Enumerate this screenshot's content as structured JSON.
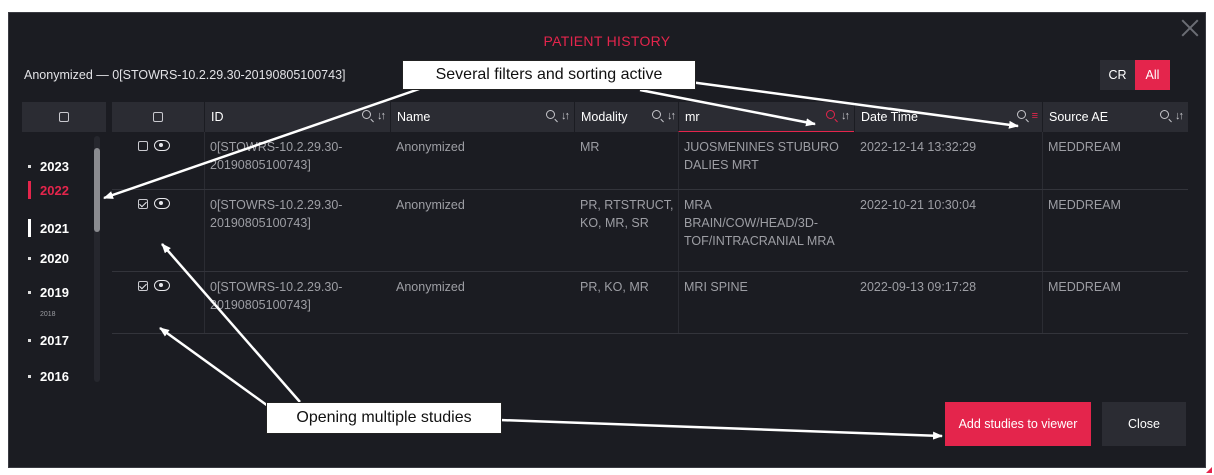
{
  "dialog": {
    "title": "PATIENT HISTORY",
    "patient_label": "Anonymized — 0[STOWRS-10.2.29.30-20190805100743]",
    "filter_buttons": [
      {
        "label": "CR",
        "active": false
      },
      {
        "label": "All",
        "active": true
      }
    ],
    "accent_color": "#e4254c"
  },
  "years": [
    {
      "label": "2023",
      "state": "normal"
    },
    {
      "label": "2022",
      "state": "active"
    },
    {
      "label": "2021",
      "state": "wide"
    },
    {
      "label": "2020",
      "state": "normal"
    },
    {
      "label": "2019",
      "state": "normal"
    },
    {
      "label": "2018",
      "state": "small"
    },
    {
      "label": "2017",
      "state": "normal"
    },
    {
      "label": "2016",
      "state": "normal"
    }
  ],
  "table": {
    "headers": {
      "id": "ID",
      "name": "Name",
      "modality": "Modality",
      "description_filter": "mr",
      "datetime": "Date Time",
      "source": "Source AE"
    },
    "rows": [
      {
        "checked": false,
        "id": "0[STOWRS-10.2.29.30-20190805100743]",
        "name": "Anonymized",
        "modality": "MR",
        "description": "JUOSMENINES STUBURO DALIES MRT",
        "datetime": "2022-12-14 13:32:29",
        "source": "MEDDREAM"
      },
      {
        "checked": true,
        "id": "0[STOWRS-10.2.29.30-20190805100743]",
        "name": "Anonymized",
        "modality": "PR, RTSTRUCT, KO, MR, SR",
        "description": "MRA BRAIN/COW/HEAD/3D-TOF/INTRACRANIAL MRA",
        "datetime": "2022-10-21 10:30:04",
        "source": "MEDDREAM"
      },
      {
        "checked": true,
        "id": "0[STOWRS-10.2.29.30-20190805100743]",
        "name": "Anonymized",
        "modality": "PR, KO, MR",
        "description": "MRI SPINE",
        "datetime": "2022-09-13 09:17:28",
        "source": "MEDDREAM"
      }
    ]
  },
  "buttons": {
    "add": "Add studies to viewer",
    "close": "Close"
  },
  "annotations": {
    "filters": "Several filters and sorting active",
    "multiple": "Opening multiple studies"
  }
}
